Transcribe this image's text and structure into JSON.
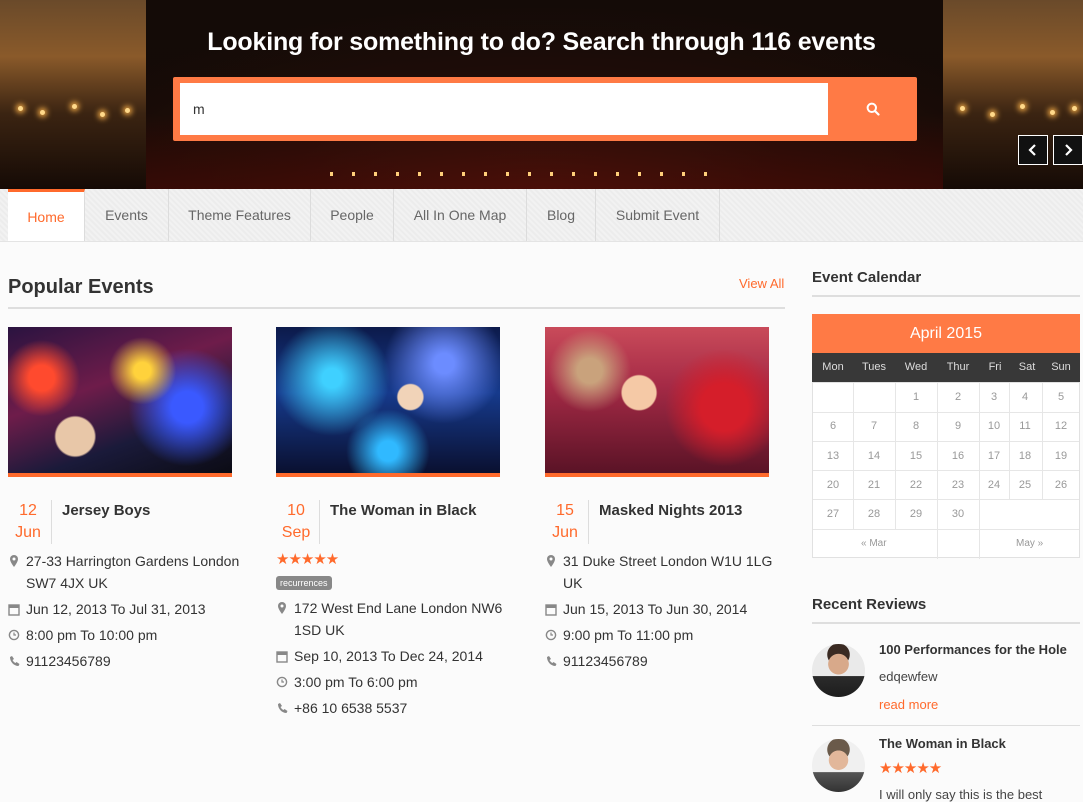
{
  "hero": {
    "heading": "Looking for something to do? Search through 116 events",
    "search_value": "m",
    "search_icon": "search-icon",
    "prev_icon": "chevron-left-icon",
    "next_icon": "chevron-right-icon"
  },
  "nav": {
    "items": [
      "Home",
      "Events",
      "Theme Features",
      "People",
      "All In One Map",
      "Blog",
      "Submit Event"
    ],
    "active": "Home"
  },
  "popular": {
    "title": "Popular Events",
    "view_all": "View All",
    "events": [
      {
        "day": "12",
        "month": "Jun",
        "title": "Jersey Boys",
        "address_line1": "27-33 Harrington Gardens London",
        "address_line2": "SW7 4JX UK",
        "dates": "Jun 12, 2013 To Jul 31, 2013",
        "time": "8:00 pm To 10:00 pm",
        "phone": "91123456789"
      },
      {
        "day": "10",
        "month": "Sep",
        "title": "The Woman in Black",
        "rating": "★★★★★",
        "tag": "recurrences",
        "address_line1": "172 West End Lane London NW6",
        "address_line2": "1SD UK",
        "dates": "Sep 10, 2013 To Dec 24, 2014",
        "time": "3:00 pm To 6:00 pm",
        "phone": "+86 10 6538 5537"
      },
      {
        "day": "15",
        "month": "Jun",
        "title": "Masked Nights 2013",
        "address_line1": "31 Duke Street London W1U 1LG",
        "address_line2": "UK",
        "dates": "Jun 15, 2013 To Jun 30, 2014",
        "time": "9:00 pm To 11:00 pm",
        "phone": "91123456789"
      }
    ]
  },
  "calendar": {
    "title": "Event Calendar",
    "month": "April 2015",
    "weekdays": [
      "Mon",
      "Tues",
      "Wed",
      "Thur",
      "Fri",
      "Sat",
      "Sun"
    ],
    "weeks": [
      [
        "",
        "",
        "1",
        "2",
        "3",
        "4",
        "5"
      ],
      [
        "6",
        "7",
        "8",
        "9",
        "10",
        "11",
        "12"
      ],
      [
        "13",
        "14",
        "15",
        "16",
        "17",
        "18",
        "19"
      ],
      [
        "20",
        "21",
        "22",
        "23",
        "24",
        "25",
        "26"
      ],
      [
        "27",
        "28",
        "29",
        "30",
        "",
        "",
        ""
      ]
    ],
    "prev": "« Mar",
    "next": "May »"
  },
  "reviews": {
    "title": "Recent Reviews",
    "items": [
      {
        "title": "100 Performances for the Hole",
        "text": "edqewfew",
        "read_more": "read more"
      },
      {
        "title": "The Woman in Black",
        "rating": "★★★★★",
        "text": "I will only say this is the best"
      }
    ]
  },
  "colors": {
    "accent": "#ff6a2c",
    "calendar_header": "#ff7a45",
    "weekday_bar": "#383838"
  }
}
